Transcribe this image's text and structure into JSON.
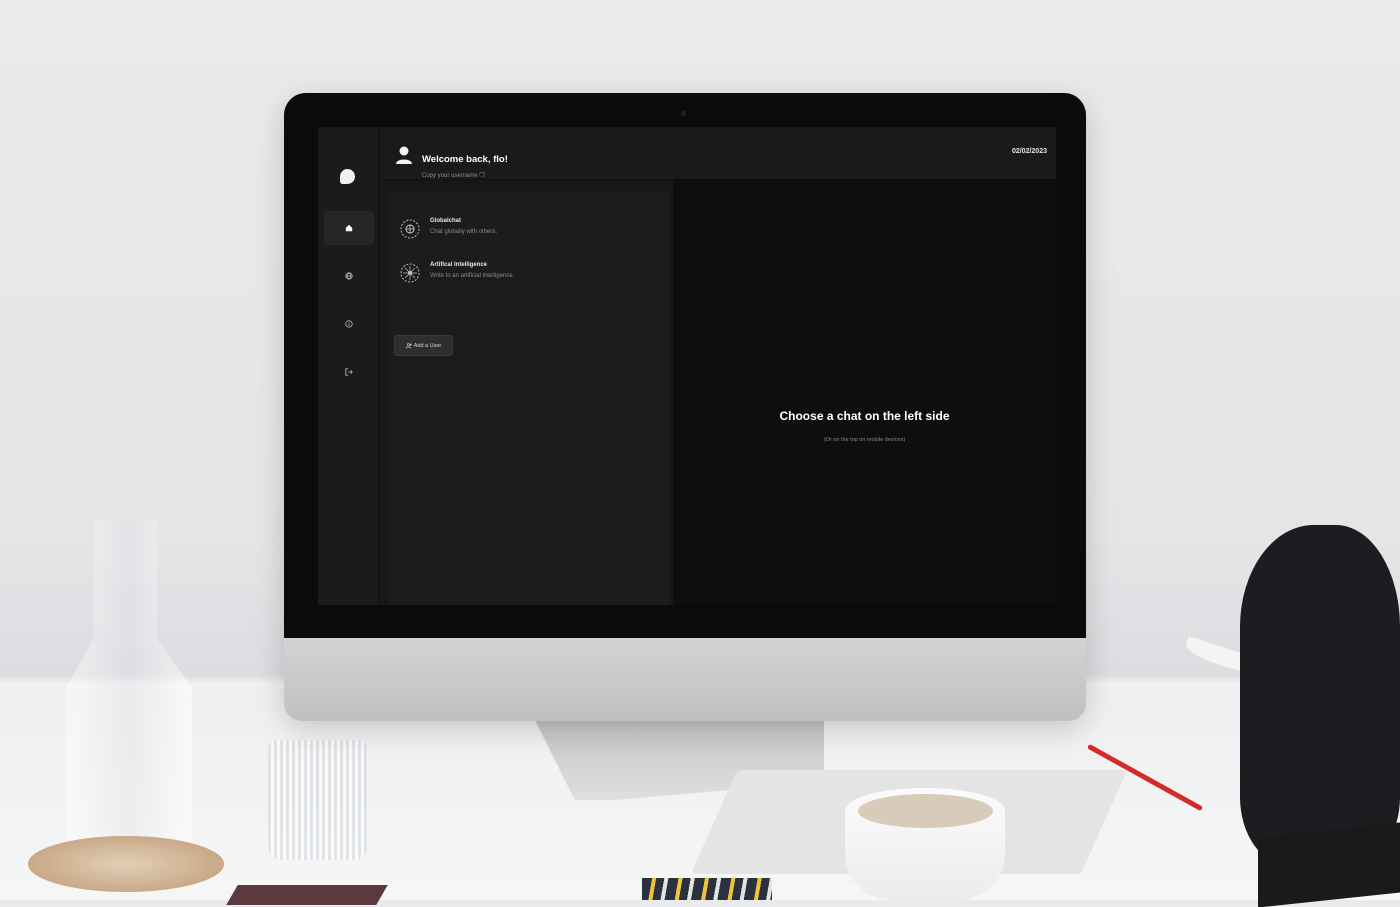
{
  "app": {
    "date": "02/02/2023",
    "header": {
      "welcome": "Welcome back, flo!",
      "copy_username": "Copy your username ❐"
    },
    "sidebar": {
      "items": [
        {
          "name": "home",
          "icon": "home-icon"
        },
        {
          "name": "globe",
          "icon": "globe-icon"
        },
        {
          "name": "info",
          "icon": "info-icon"
        },
        {
          "name": "logout",
          "icon": "logout-icon"
        }
      ]
    },
    "chats": [
      {
        "title": "Globalchat",
        "subtitle": "Chat globally with others."
      },
      {
        "title": "Artifical Intelligence",
        "subtitle": "Write to an artificial intelligence."
      }
    ],
    "add_user_label": "Add a User",
    "empty_state": {
      "title": "Choose a chat on the left side",
      "subtitle": "(Or on the top on mobile devices)"
    }
  },
  "colors": {
    "screen_bg": "#171717",
    "chat_pane_bg": "#0e0e0e",
    "text": "#ffffff",
    "muted": "#8a8a8a"
  }
}
